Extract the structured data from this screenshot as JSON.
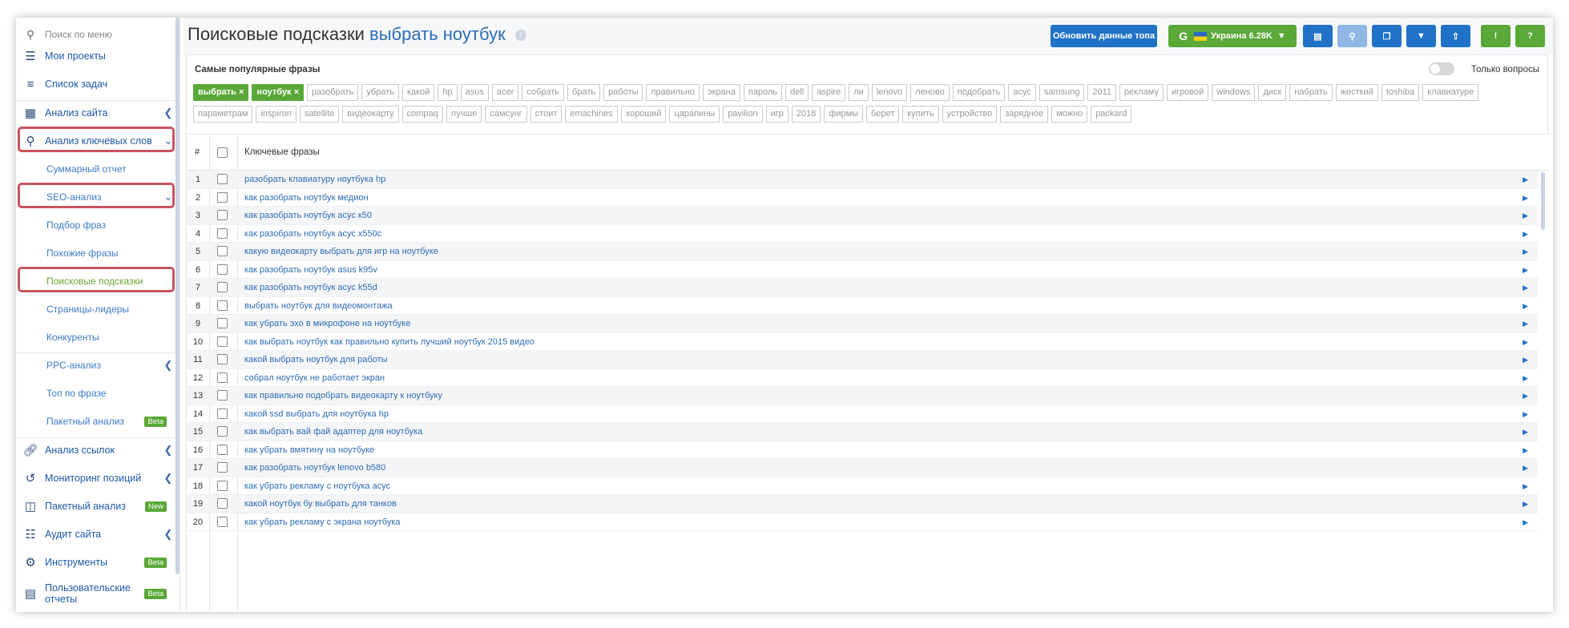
{
  "sidebar": {
    "search_placeholder": "Поиск по меню",
    "items": [
      {
        "label": "Мои проекты",
        "icon": "menu-icon"
      },
      {
        "label": "Список задач",
        "icon": "list-icon"
      },
      {
        "label": "Анализ сайта",
        "icon": "site-analysis-icon"
      },
      {
        "label": "Анализ ключевых слов",
        "icon": "key-icon"
      },
      {
        "label": "Суммарный отчет"
      },
      {
        "label": "SEO-анализ"
      },
      {
        "label": "Подбор фраз"
      },
      {
        "label": "Похожие фразы"
      },
      {
        "label": "Поисковые подсказки"
      },
      {
        "label": "Страницы-лидеры"
      },
      {
        "label": "Конкуренты"
      },
      {
        "label": "PPC-анализ"
      },
      {
        "label": "Топ по фразе"
      },
      {
        "label": "Пакетный анализ",
        "badge": "Beta"
      },
      {
        "label": "Анализ ссылок",
        "icon": "link-icon"
      },
      {
        "label": "Мониторинг позиций",
        "icon": "history-icon"
      },
      {
        "label": "Пакетный анализ",
        "icon": "database-icon",
        "badge": "New"
      },
      {
        "label": "Аудит сайта",
        "icon": "sitemap-icon"
      },
      {
        "label": "Инструменты",
        "icon": "gear-icon",
        "badge": "Beta"
      },
      {
        "label": "Пользовательские отчеты",
        "icon": "report-icon",
        "badge": "Beta"
      }
    ]
  },
  "header": {
    "title": "Поисковые подсказки",
    "keyword": "выбрать ноутбук",
    "update_button": "Обновить данные топа",
    "region_button": "Украина 6.28K"
  },
  "popular": {
    "title": "Самые популярные фразы",
    "toggle_label": "Только вопросы",
    "selected_tags": [
      "выбрать ×",
      "ноутбук ×"
    ],
    "tags_row1": [
      "разобрать",
      "убрать",
      "какой",
      "hp",
      "asus",
      "acer",
      "собрать",
      "брать",
      "работы",
      "правильно",
      "экрана",
      "пароль",
      "dell",
      "aspire",
      "ли",
      "lenovo",
      "леново",
      "подобрать",
      "асус",
      "samsung",
      "2011",
      "рекламу",
      "игровой",
      "windows",
      "диск",
      "набрать",
      "жесткий",
      "toshiba",
      "клавиатуре"
    ],
    "tags_row2": [
      "параметрам",
      "inspiron",
      "satellite",
      "видеокарту",
      "compaq",
      "лучше",
      "самсунг",
      "стоит",
      "emachines",
      "хороший",
      "царапины",
      "pavilion",
      "игр",
      "2018",
      "фирмы",
      "берет",
      "купить",
      "устройство",
      "зарядное",
      "можно",
      "packard"
    ]
  },
  "table": {
    "col_num": "#",
    "col_phrase": "Ключевые фразы",
    "rows": [
      {
        "n": "1",
        "phrase": "разобрать клавиатуру ноутбука hp"
      },
      {
        "n": "2",
        "phrase": "как разобрать ноутбук медион"
      },
      {
        "n": "3",
        "phrase": "как разобрать ноутбук асус к50"
      },
      {
        "n": "4",
        "phrase": "как разобрать ноутбук асус x550c"
      },
      {
        "n": "5",
        "phrase": "какую видеокарту выбрать для игр на ноутбуке"
      },
      {
        "n": "6",
        "phrase": "как разобрать ноутбук asus k95v"
      },
      {
        "n": "7",
        "phrase": "как разобрать ноутбук асус k55d"
      },
      {
        "n": "8",
        "phrase": "выбрать ноутбук для видеомонтажа"
      },
      {
        "n": "9",
        "phrase": "как убрать эхо в микрофоне на ноутбуке"
      },
      {
        "n": "10",
        "phrase": "как выбрать ноутбук как правильно купить лучший ноутбук 2015 видео"
      },
      {
        "n": "11",
        "phrase": "какой выбрать ноутбук для работы"
      },
      {
        "n": "12",
        "phrase": "собрал ноутбук не работает экран"
      },
      {
        "n": "13",
        "phrase": "как правильно подобрать видеокарту к ноутбуку"
      },
      {
        "n": "14",
        "phrase": "какой ssd выбрать для ноутбука hp"
      },
      {
        "n": "15",
        "phrase": "как выбрать вай фай адаптер для ноутбука"
      },
      {
        "n": "16",
        "phrase": "как убрать вмятину на ноутбуке"
      },
      {
        "n": "17",
        "phrase": "как разобрать ноутбук lenovo b580"
      },
      {
        "n": "18",
        "phrase": "как убрать рекламу с ноутбука асус"
      },
      {
        "n": "19",
        "phrase": "какой ноутбук бу выбрать для танков"
      },
      {
        "n": "20",
        "phrase": "как убрать рекламу с экрана ноутбука"
      }
    ]
  }
}
